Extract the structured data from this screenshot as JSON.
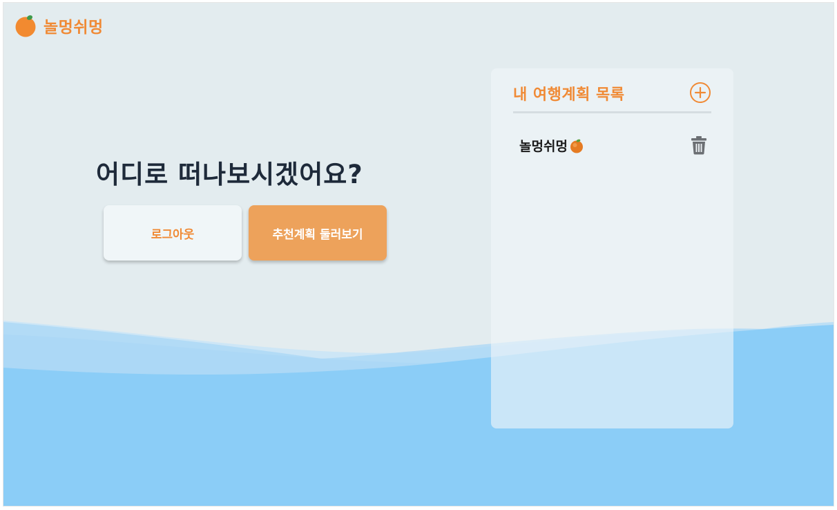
{
  "app": {
    "logo_text": "놀멍쉬멍",
    "logo_icon": "tangerine-icon"
  },
  "main": {
    "headline": "어디로 떠나보시겠어요?",
    "logout_label": "로그아웃",
    "recommend_label": "추천계획 둘러보기"
  },
  "plans_panel": {
    "title": "내 여행계획 목록",
    "add_icon": "plus-circle-icon",
    "items": [
      {
        "name": "놀멍쉬멍",
        "icon": "tangerine-icon",
        "delete_icon": "trash-icon"
      }
    ]
  },
  "colors": {
    "accent": "#f08a35",
    "recommend_button": "#eda25b",
    "background": "#e3ecef",
    "wave": "#8bcdf7",
    "text_dark": "#1e2a3a",
    "icon_gray": "#6b6f73"
  }
}
